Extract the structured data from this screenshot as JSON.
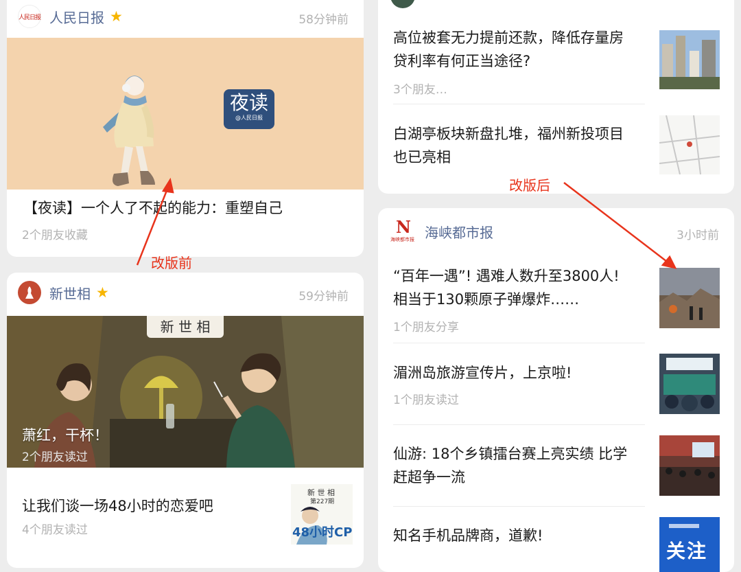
{
  "left": {
    "post1": {
      "source": "人民日报",
      "logo_text": "人民日报",
      "time": "58分钟前",
      "cover_badge": "夜读",
      "cover_badge_sub": "@人民日报",
      "title": "【夜读】一个人了不起的能力：重塑自己",
      "meta": "2个朋友收藏"
    },
    "post2": {
      "source": "新世相",
      "time": "59分钟前",
      "cover_banner": "新 世 相",
      "cover_title": "萧红，干杯！",
      "cover_meta": "2个朋友读过",
      "item_title": "让我们谈一场48小时的恋爱吧",
      "item_meta": "4个朋友读过",
      "thumb_line1": "新 世 相",
      "thumb_line2": "第227期",
      "thumb_big": "48小时CP"
    }
  },
  "right": {
    "card1": {
      "items": [
        {
          "title_l1": "高位被套无力提前还款，降低存量房",
          "title_l2": "贷利率有何正当途径?",
          "meta": "3个朋友…"
        },
        {
          "title_l1": "白湖亭板块新盘扎堆，福州新投项目",
          "title_l2": "也已亮相",
          "meta": ""
        }
      ]
    },
    "card2": {
      "source": "海峡都市报",
      "logo_text": "N",
      "logo_sub": "海峡都市报",
      "time": "3小时前",
      "items": [
        {
          "title_l1": "“百年一遇”! 遇难人数升至3800人!",
          "title_l2": "相当于130颗原子弹爆炸……",
          "meta": "1个朋友分享"
        },
        {
          "title_l1": "湄洲岛旅游宣传片，上京啦!",
          "title_l2": "",
          "meta": "1个朋友读过"
        },
        {
          "title_l1": "仙游: 18个乡镇擂台赛上亮实绩 比学",
          "title_l2": "赶超争一流",
          "meta": ""
        },
        {
          "title_l1": "知名手机品牌商，道歉!",
          "title_l2": "",
          "meta": ""
        }
      ],
      "thumb4_text": "关注"
    }
  },
  "annotations": {
    "before": "改版前",
    "after": "改版后",
    "color": "#e8341c"
  }
}
